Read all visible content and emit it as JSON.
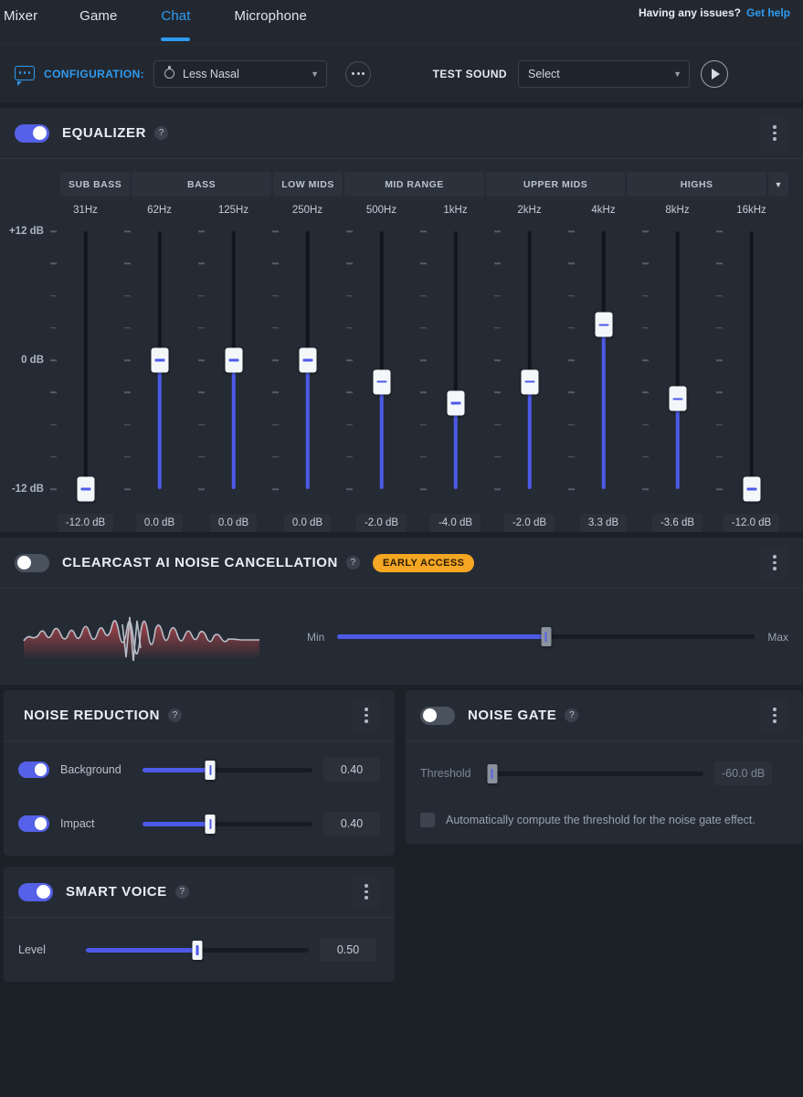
{
  "tabs": [
    {
      "label": "Mixer",
      "active": false
    },
    {
      "label": "Game",
      "active": false
    },
    {
      "label": "Chat",
      "active": true
    },
    {
      "label": "Microphone",
      "active": false
    }
  ],
  "help": {
    "question": "Having any issues?",
    "link": "Get help"
  },
  "config_bar": {
    "icon": "speech-bubble-icon",
    "label": "CONFIGURATION:",
    "selected_preset": "Less Nasal",
    "preset_icon": "gear-icon",
    "caret": "▼",
    "more_button": "more-options-ellipsis",
    "test_sound_label": "TEST SOUND",
    "test_sound_value": "Select",
    "play_button": "play-icon"
  },
  "equalizer": {
    "title": "EQUALIZER",
    "enabled": true,
    "help": "?",
    "menu": "kebab-menu",
    "bands": [
      {
        "label": "SUB BASS",
        "flex": 1
      },
      {
        "label": "BASS",
        "flex": 2
      },
      {
        "label": "LOW MIDS",
        "flex": 1
      },
      {
        "label": "MID RANGE",
        "flex": 2
      },
      {
        "label": "UPPER MIDS",
        "flex": 2
      },
      {
        "label": "HIGHS",
        "flex": 2
      }
    ],
    "band_caret": "▼",
    "axis_labels": [
      "+12 dB",
      "0 dB",
      "-12 dB"
    ],
    "chart_data": {
      "type": "bar",
      "title": "EQUALIZER",
      "xlabel": "",
      "ylabel": "dB",
      "ylim": [
        -12,
        12
      ],
      "categories": [
        "31Hz",
        "62Hz",
        "125Hz",
        "250Hz",
        "500Hz",
        "1kHz",
        "2kHz",
        "4kHz",
        "8kHz",
        "16kHz"
      ],
      "values": [
        -12.0,
        0.0,
        0.0,
        0.0,
        -2.0,
        -4.0,
        -2.0,
        3.3,
        -3.6,
        -12.0
      ],
      "value_labels": [
        "-12.0 dB",
        "0.0 dB",
        "0.0 dB",
        "0.0 dB",
        "-2.0 dB",
        "-4.0 dB",
        "-2.0 dB",
        "3.3 dB",
        "-3.6 dB",
        "-12.0 dB"
      ],
      "grid": false,
      "legend": "none"
    }
  },
  "clearcast": {
    "title": "CLEARCAST AI NOISE CANCELLATION",
    "enabled": false,
    "help": "?",
    "badge": "EARLY ACCESS",
    "menu": "kebab-menu",
    "min_label": "Min",
    "max_label": "Max",
    "slider_percent": 50
  },
  "noise_reduction": {
    "title": "NOISE REDUCTION",
    "help": "?",
    "menu": "kebab-menu",
    "rows": [
      {
        "label": "Background",
        "enabled": true,
        "value": "0.40",
        "percent": 40
      },
      {
        "label": "Impact",
        "enabled": true,
        "value": "0.40",
        "percent": 40
      }
    ]
  },
  "noise_gate": {
    "title": "NOISE GATE",
    "enabled": false,
    "help": "?",
    "menu": "kebab-menu",
    "threshold_label": "Threshold",
    "threshold_value": "-60.0 dB",
    "threshold_percent": 2,
    "checkbox_checked": false,
    "checkbox_label": "Automatically compute the threshold for the noise gate effect."
  },
  "smart_voice": {
    "title": "SMART VOICE",
    "enabled": true,
    "help": "?",
    "menu": "kebab-menu",
    "level_label": "Level",
    "level_value": "0.50",
    "level_percent": 50
  }
}
